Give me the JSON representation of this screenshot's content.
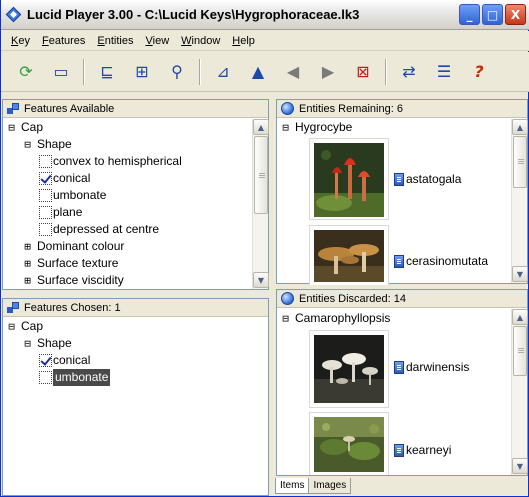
{
  "window": {
    "title": "Lucid Player 3.00 - C:\\Lucid Keys\\Hygrophoraceae.lk3",
    "controls": {
      "minimize": "_",
      "maximize": "□",
      "close": "X"
    }
  },
  "menu": [
    {
      "label": "Key",
      "underline": "K",
      "rest": "ey"
    },
    {
      "label": "Features",
      "underline": "F",
      "rest": "eatures"
    },
    {
      "label": "Entities",
      "underline": "E",
      "rest": "ntities"
    },
    {
      "label": "View",
      "underline": "V",
      "rest": "iew"
    },
    {
      "label": "Window",
      "underline": "W",
      "rest": "indow"
    },
    {
      "label": "Help",
      "underline": "H",
      "rest": "elp"
    }
  ],
  "toolbar": {
    "icons": [
      "restart-icon",
      "open-key-icon",
      "prune-features-icon",
      "best-feature-icon",
      "find-icon",
      "filter-icon",
      "auto-key-icon",
      "back-icon",
      "forward-icon",
      "clear-features-icon",
      "differences-icon",
      "list-icon",
      "help-icon"
    ],
    "glyphs": [
      "⟳",
      "▭",
      "⊑",
      "⊞",
      "⚲",
      "⊿",
      "▲",
      "◀",
      "▶",
      "⊠",
      "⇄",
      "☰",
      "?"
    ],
    "colors": {
      "restart": "#2f9e3e",
      "help": "#c62b00",
      "arrows": "#7a7a7a"
    }
  },
  "features_available": {
    "header": "Features Available",
    "tree": [
      {
        "type": "node",
        "label": "Cap",
        "expander": "⊟",
        "level": 0
      },
      {
        "type": "node",
        "label": "Shape",
        "expander": "⊟",
        "level": 1
      },
      {
        "type": "state",
        "label": "convex to hemispherical",
        "checked": false,
        "level": 2
      },
      {
        "type": "state",
        "label": "conical",
        "checked": true,
        "level": 2
      },
      {
        "type": "state",
        "label": "umbonate",
        "checked": false,
        "level": 2
      },
      {
        "type": "state",
        "label": "plane",
        "checked": false,
        "level": 2
      },
      {
        "type": "state",
        "label": "depressed at centre",
        "checked": false,
        "level": 2
      },
      {
        "type": "node",
        "label": "Dominant colour",
        "expander": "⊞",
        "level": 1
      },
      {
        "type": "node",
        "label": "Surface texture",
        "expander": "⊞",
        "level": 1
      },
      {
        "type": "node",
        "label": "Surface viscidity",
        "expander": "⊞",
        "level": 1
      }
    ]
  },
  "features_chosen": {
    "header": "Features Chosen: 1",
    "tree": [
      {
        "type": "node",
        "label": "Cap",
        "expander": "⊟",
        "level": 0
      },
      {
        "type": "node",
        "label": "Shape",
        "expander": "⊟",
        "level": 1
      },
      {
        "type": "state",
        "label": "conical",
        "checked": true,
        "level": 2
      },
      {
        "type": "state",
        "label": "umbonate",
        "checked": false,
        "level": 2,
        "selected": true
      }
    ]
  },
  "entities_remaining": {
    "header": "Entities Remaining: 6",
    "group": {
      "label": "Hygrocybe",
      "expander": "⊟"
    },
    "items": [
      {
        "name": "astatogala",
        "image": "red-mushroom-photo"
      },
      {
        "name": "cerasinomutata",
        "image": "brown-mushroom-photo"
      }
    ]
  },
  "entities_discarded": {
    "header": "Entities Discarded: 14",
    "group": {
      "label": "Camarophyllopsis",
      "expander": "⊟"
    },
    "items": [
      {
        "name": "darwinensis",
        "image": "white-mushroom-photo"
      },
      {
        "name": "kearneyi",
        "image": "moss-mushroom-photo"
      }
    ]
  },
  "tabs": [
    {
      "label": "Items",
      "active": true
    },
    {
      "label": "Images",
      "active": false
    }
  ]
}
